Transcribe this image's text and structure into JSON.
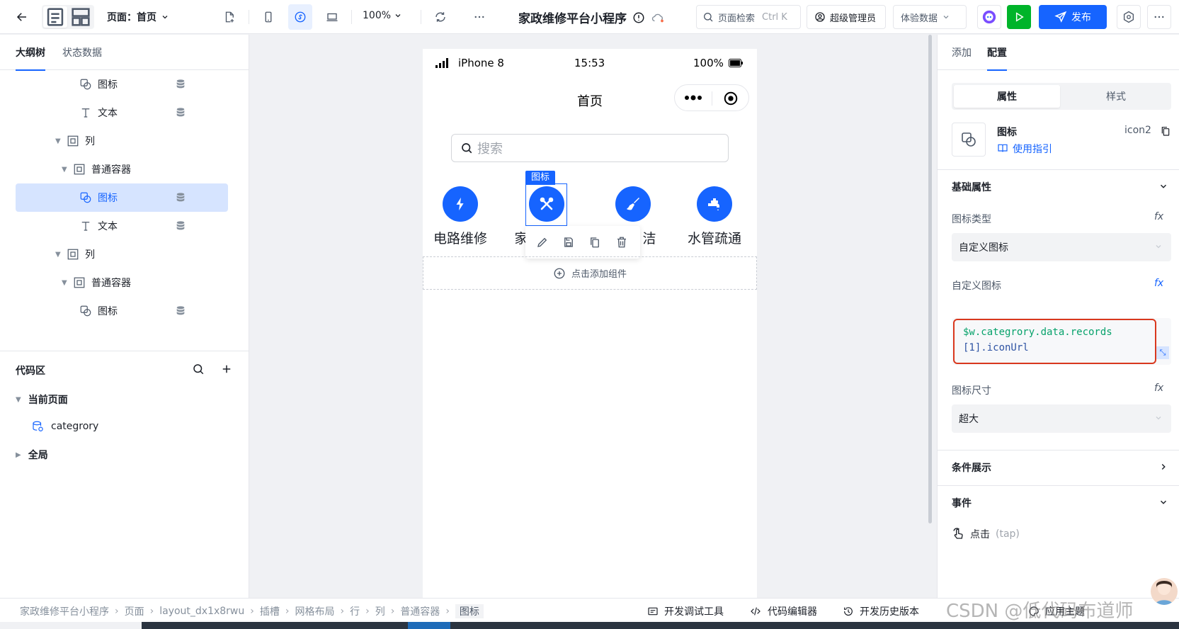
{
  "topbar": {
    "page_select": "页面：首页",
    "zoom": "100%",
    "app_title": "家政维修平台小程序",
    "search_placeholder": "页面检索",
    "search_shortcut": "Ctrl K",
    "admin_label": "超级管理员",
    "exp_data_label": "体验数据",
    "publish_label": "发布"
  },
  "left": {
    "tabs": [
      "大纲树",
      "状态数据"
    ],
    "tree": [
      {
        "label": "图标",
        "type": "icon"
      },
      {
        "label": "文本",
        "type": "text"
      },
      {
        "label": "列",
        "type": "box"
      },
      {
        "label": "普通容器",
        "type": "box"
      },
      {
        "label": "图标",
        "type": "icon"
      },
      {
        "label": "文本",
        "type": "text"
      },
      {
        "label": "列",
        "type": "box"
      },
      {
        "label": "普通容器",
        "type": "box"
      },
      {
        "label": "图标",
        "type": "icon"
      }
    ],
    "code_title": "代码区",
    "current_page": "当前页面",
    "datasource": "categrory",
    "global": "全局"
  },
  "phone": {
    "carrier": "iPhone 8",
    "time": "15:53",
    "battery": "100%",
    "nav_title": "首页",
    "search_placeholder": "搜索",
    "categories": [
      {
        "label": "电路维修",
        "icon": "bolt-icon"
      },
      {
        "label": "家",
        "icon": "tools-icon"
      },
      {
        "label": "洁",
        "icon": "broom-icon"
      },
      {
        "label": "水管疏通",
        "icon": "faucet-icon"
      }
    ],
    "selected_tag": "图标",
    "add_component": "点击添加组件"
  },
  "right": {
    "tabs": [
      "添加",
      "配置"
    ],
    "seg": [
      "属性",
      "样式"
    ],
    "component_name": "图标",
    "component_id": "icon2",
    "guide_link": "使用指引",
    "basic_props": "基础属性",
    "icon_type_label": "图标类型",
    "icon_type_value": "自定义图标",
    "custom_icon_label": "自定义图标",
    "code_line1": "$w.categrory.data.records",
    "code_line2": "[1].iconUrl",
    "icon_size_label": "图标尺寸",
    "icon_size_value": "超大",
    "condition": "条件展示",
    "events": "事件",
    "tap_event": "点击",
    "tap_event_en": "(tap)",
    "fx": "fx"
  },
  "bottombar": {
    "crumbs": [
      "家政维修平台小程序",
      "页面",
      "layout_dx1x8rwu",
      "插槽",
      "网格布局",
      "行",
      "列",
      "普通容器",
      "图标"
    ],
    "dev_tools": "开发调试工具",
    "code_editor": "代码编辑器",
    "history": "开发历史版本",
    "theme": "应用主题"
  },
  "watermark": "CSDN @低代码布道师",
  "colors": {
    "accent": "#1664ff",
    "run": "#00b42a",
    "highlight": "#d9381e",
    "selected": "#d6e4ff"
  }
}
